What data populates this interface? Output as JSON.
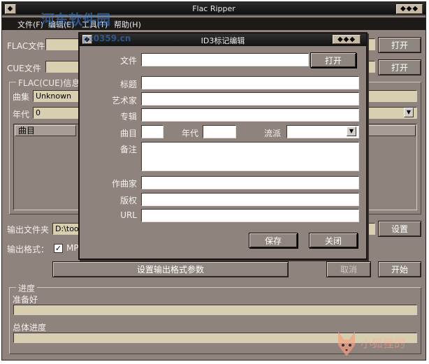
{
  "window": {
    "title": "Flac Ripper",
    "deco_right": "◆◆◆"
  },
  "menu": {
    "file": "文件(F)",
    "edit": "编辑(E)",
    "tools": "工具(T)",
    "help": "帮助(H)"
  },
  "main": {
    "flac_label": "FLAC文件",
    "cue_label": "CUE文件",
    "open_label": "打开",
    "info_group": "FLAC(CUE)信息",
    "album_label": "曲集",
    "album_value": "Unknown",
    "year_label": "年代",
    "year_value": "0",
    "track_col": "曲目",
    "output_folder_label": "输出文件夹",
    "output_folder_value": "D:\\tool",
    "settings_button": "设置",
    "output_format_label": "输出格式：",
    "mp3_label": "MP",
    "format_params_button": "设置输出格式参数",
    "cancel_button": "取消",
    "start_button": "开始",
    "progress_group": "进度",
    "ready_text": "准备好",
    "total_progress_label": "总体进度"
  },
  "dialog": {
    "title": "ID3标记编辑",
    "deco": "◆◆◆",
    "file_label": "文件",
    "open_button": "打开",
    "title_label": "标题",
    "artist_label": "艺术家",
    "album_label": "专辑",
    "track_label": "曲目",
    "year_label": "年代",
    "genre_label": "流派",
    "comment_label": "备注",
    "composer_label": "作曲家",
    "copyright_label": "版权",
    "url_label": "URL",
    "save_button": "保存",
    "close_button": "关闭"
  },
  "watermark": {
    "site": "河东软件园",
    "url": "pc0359.cn",
    "corner": "小狐狸的"
  }
}
